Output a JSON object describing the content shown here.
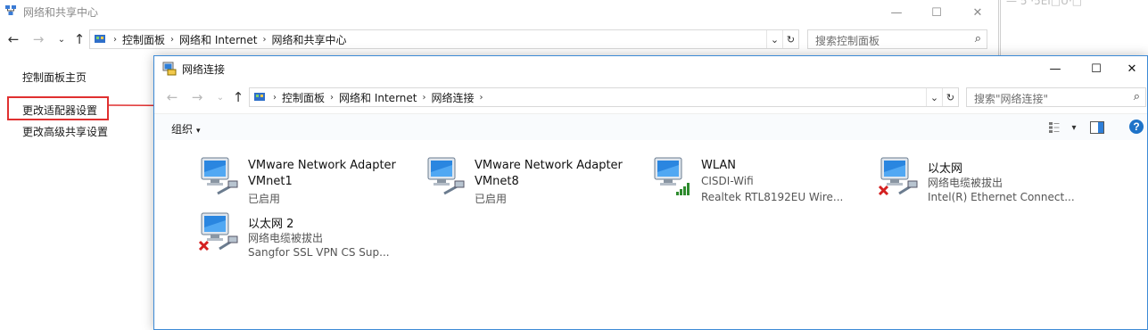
{
  "back_window": {
    "title": "网络和共享中心",
    "controls": {
      "minimize": "—",
      "maximize": "☐",
      "close": "✕"
    },
    "nav": {
      "back": "←",
      "forward": "→",
      "recent": "⌄",
      "up": "↑"
    },
    "breadcrumb": [
      "控制面板",
      "网络和 Internet",
      "网络和共享中心"
    ],
    "address_buttons": {
      "dropdown": "⌄",
      "refresh": "↻"
    },
    "search_placeholder": "搜索控制面板",
    "left_nav": [
      "控制面板主页",
      "更改适配器设置",
      "更改高级共享设置"
    ],
    "right_strip_fragment": "— 5 ·5EI□U·□"
  },
  "front_window": {
    "title": "网络连接",
    "controls": {
      "minimize": "—",
      "maximize": "☐",
      "close": "✕"
    },
    "nav": {
      "back": "←",
      "forward": "→",
      "recent": "⌄",
      "up": "↑"
    },
    "breadcrumb": [
      "控制面板",
      "网络和 Internet",
      "网络连接"
    ],
    "address_buttons": {
      "dropdown": "⌄",
      "refresh": "↻"
    },
    "search_placeholder": "搜索\"网络连接\"",
    "toolbar": {
      "organize": "组织",
      "organize_caret": "▾",
      "view_caret": "▾",
      "help": "?"
    },
    "connections": [
      {
        "name": "VMware Network Adapter",
        "line2": "VMnet1",
        "line3": "已启用",
        "status_icon": "ethernet-cable-icon"
      },
      {
        "name": "VMware Network Adapter",
        "line2": "VMnet8",
        "line3": "已启用",
        "status_icon": "ethernet-cable-icon"
      },
      {
        "name": "WLAN",
        "line2": "CISDI-Wifi",
        "line3": "Realtek RTL8192EU Wire...",
        "status_icon": "wifi-signal-icon"
      },
      {
        "name": "以太网",
        "line2": "网络电缆被拔出",
        "line3": "Intel(R) Ethernet Connect...",
        "status_icon": "disconnected-x-icon"
      },
      {
        "name": "以太网 2",
        "line2": "网络电缆被拔出",
        "line3": "Sangfor SSL VPN CS Sup...",
        "status_icon": "disconnected-x-icon"
      }
    ]
  },
  "colors": {
    "highlight_box": "#e03030",
    "window_border": "#3c8ad6",
    "help_icon": "#1e73c8",
    "signal_green": "#2e8b2e"
  }
}
